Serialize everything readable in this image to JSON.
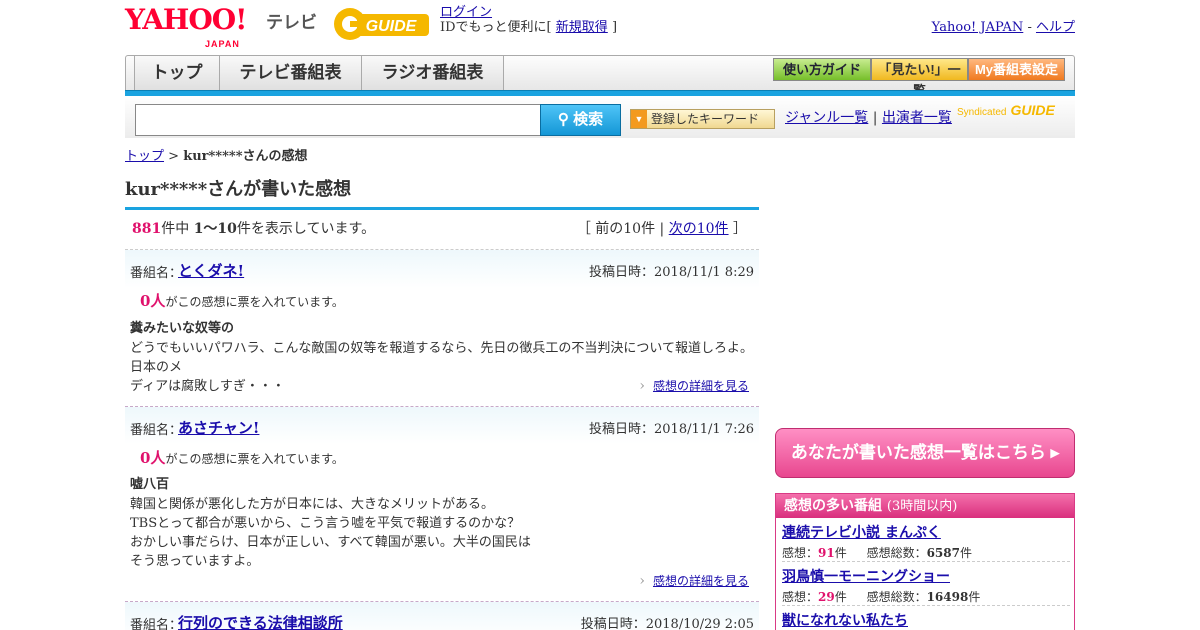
{
  "header": {
    "logo": "YAHOO!",
    "logo_sub": "JAPAN",
    "tv_label": "テレビ",
    "gguide_logo": "GUIDE",
    "login": "ログイン",
    "login_text": "IDでもっと便利に[",
    "signup": "新規取得",
    "login_close": "]",
    "yahoo_japan": "Yahoo! JAPAN",
    "sep": "-",
    "help": "ヘルプ"
  },
  "nav": {
    "tabs": [
      "トップ",
      "テレビ番組表",
      "ラジオ番組表"
    ],
    "guide": "使い方ガイド",
    "mitai": "「見たい!」一覧",
    "my": "My番組表設定"
  },
  "search": {
    "value": "",
    "button": "検索",
    "keyword": "登録したキーワード",
    "genre": "ジャンル一覧",
    "divider": "|",
    "performer": "出演者一覧",
    "syndicated": "Syndicated",
    "syndicated_logo": "GUIDE"
  },
  "breadcrumb": {
    "top": "トップ",
    "sep": ">",
    "current": "kur*****さんの感想"
  },
  "page_title": "kur*****さんが書いた感想",
  "pager": {
    "total": "881",
    "mid": "件中",
    "range": "1～10",
    "suffix": "件を表示しています。",
    "open": "［",
    "prev": "前の10件",
    "sep": "|",
    "next": "次の10件",
    "close": "］"
  },
  "entries": [
    {
      "label": "番組名：",
      "program": "とくダネ!",
      "date": "投稿日時：2018/11/1 8:29",
      "votes": "0人",
      "votes_text": "がこの感想に票を入れています。",
      "title": "糞みたいな奴等の",
      "body": [
        "どうでもいいパワハラ、こんな敵国の奴等を報道するなら、先日の徴兵工の不当判決について報道しろよ。日本のメ",
        "ディアは腐敗しすぎ・・・"
      ],
      "detail": "感想の詳細を見る"
    },
    {
      "label": "番組名：",
      "program": "あさチャン!",
      "date": "投稿日時：2018/11/1 7:26",
      "votes": "0人",
      "votes_text": "がこの感想に票を入れています。",
      "title": "嘘八百",
      "body": [
        "韓国と関係が悪化した方が日本には、大きなメリットがある。",
        "TBSとって都合が悪いから、こう言う嘘を平気で報道するのかな？",
        "おかしい事だらけ、日本が正しい、すべて韓国が悪い。大半の国民は",
        "そう思っていますよ。"
      ],
      "detail": "感想の詳細を見る"
    },
    {
      "label": "番組名：",
      "program": "行列のできる法律相談所",
      "date": "投稿日時：2018/10/29 2:05"
    }
  ],
  "sidebar": {
    "my_button": "あなたが書いた感想一覧はこちら",
    "ranking_title": "感想の多い番組",
    "ranking_sub": "(3時間以内)",
    "ranking": [
      {
        "title": "連続テレビ小説 まんぷく",
        "kanso_label": "感想：",
        "kanso": "91",
        "ken": "件",
        "total_label": "感想総数：",
        "total": "6587",
        "ken2": "件"
      },
      {
        "title": "羽鳥慎一モーニングショー",
        "kanso_label": "感想：",
        "kanso": "29",
        "ken": "件",
        "total_label": "感想総数：",
        "total": "16498",
        "ken2": "件"
      },
      {
        "title": "獣になれない私たち"
      }
    ]
  },
  "colors": {
    "accent_blue": "#1aa3e0",
    "pink": "#e0116c",
    "link": "#1a0dab"
  }
}
